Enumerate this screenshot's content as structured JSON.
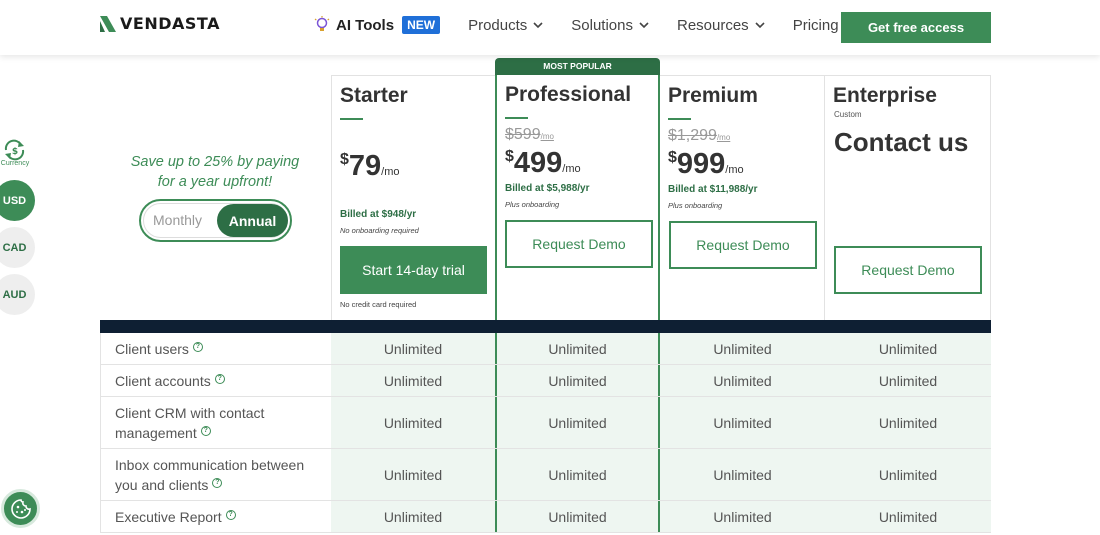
{
  "brand": {
    "name": "VENDASTA",
    "color": "#3d8c57"
  },
  "nav": {
    "ai_tools": "AI Tools",
    "ai_badge": "NEW",
    "products": "Products",
    "solutions": "Solutions",
    "resources": "Resources",
    "pricing": "Pricing",
    "cta": "Get free access"
  },
  "currency": {
    "label": "Currency",
    "options": [
      "USD",
      "CAD",
      "AUD"
    ],
    "selected": "USD"
  },
  "billing": {
    "promo_line1": "Save up to 25% by paying",
    "promo_line2": "for a year upfront!",
    "monthly": "Monthly",
    "annual": "Annual",
    "selected": "Annual"
  },
  "plans": {
    "starter": {
      "name": "Starter",
      "currency_symbol": "$",
      "price": "79",
      "per": "/mo",
      "billed": "Billed at $948/yr",
      "note": "No onboarding required",
      "button": "Start 14-day trial",
      "footnote": "No credit card required"
    },
    "professional": {
      "badge": "MOST POPULAR",
      "name": "Professional",
      "old_price": "$599",
      "old_per": "/mo",
      "currency_symbol": "$",
      "price": "499",
      "per": "/mo",
      "billed": "Billed at $5,988/yr",
      "note": "Plus onboarding",
      "button": "Request Demo"
    },
    "premium": {
      "name": "Premium",
      "old_price": "$1,299",
      "old_per": "/mo",
      "currency_symbol": "$",
      "price": "999",
      "per": "/mo",
      "billed": "Billed at $11,988/yr",
      "note": "Plus onboarding",
      "button": "Request Demo"
    },
    "enterprise": {
      "name": "Enterprise",
      "subtitle": "Custom",
      "price_text": "Contact us",
      "button": "Request Demo"
    }
  },
  "features": [
    {
      "label": "Client users",
      "values": [
        "Unlimited",
        "Unlimited",
        "Unlimited",
        "Unlimited"
      ]
    },
    {
      "label": "Client accounts",
      "values": [
        "Unlimited",
        "Unlimited",
        "Unlimited",
        "Unlimited"
      ]
    },
    {
      "label": "Client CRM with contact management",
      "values": [
        "Unlimited",
        "Unlimited",
        "Unlimited",
        "Unlimited"
      ]
    },
    {
      "label": "Inbox communication between you and clients",
      "values": [
        "Unlimited",
        "Unlimited",
        "Unlimited",
        "Unlimited"
      ]
    },
    {
      "label": "Executive Report",
      "values": [
        "Unlimited",
        "Unlimited",
        "Unlimited",
        "Unlimited"
      ]
    }
  ],
  "help_icon_glyph": "?"
}
